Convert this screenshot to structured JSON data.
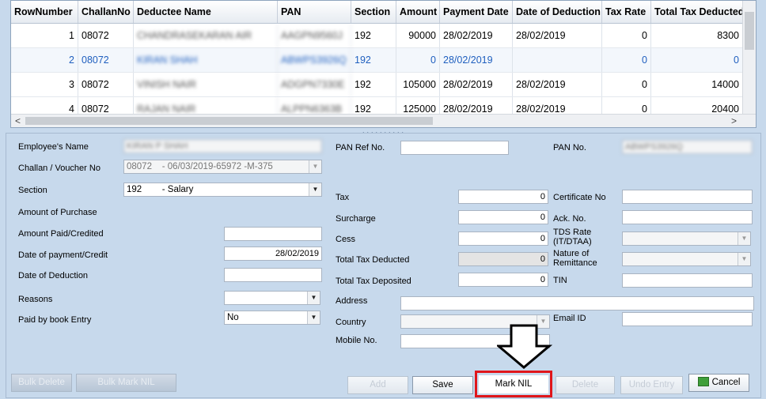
{
  "grid": {
    "columns": [
      "RowNumber",
      "ChallanNo",
      "Deductee Name",
      "PAN",
      "Section",
      "Amount",
      "Payment Date",
      "Date of Deduction",
      "Tax Rate",
      "Total Tax Deducted"
    ],
    "rows": [
      {
        "row": "1",
        "challan": "08072",
        "name": "CHANDRASEKARAN AIR",
        "pan": "AAGPN9560J",
        "section": "192",
        "amount": "90000",
        "payment_date": "28/02/2019",
        "deduction_date": "28/02/2019",
        "tax_rate": "0",
        "total_tax": "8300"
      },
      {
        "row": "2",
        "challan": "08072",
        "name": "KIRAN SHAH",
        "pan": "ABWPS3926Q",
        "section": "192",
        "amount": "0",
        "payment_date": "28/02/2019",
        "deduction_date": "",
        "tax_rate": "0",
        "total_tax": "0"
      },
      {
        "row": "3",
        "challan": "08072",
        "name": "VINISH NAIR",
        "pan": "ADGPN7330E",
        "section": "192",
        "amount": "105000",
        "payment_date": "28/02/2019",
        "deduction_date": "28/02/2019",
        "tax_rate": "0",
        "total_tax": "14000"
      },
      {
        "row": "4",
        "challan": "08072",
        "name": "RAJAN NAIR",
        "pan": "ALPPN6363B",
        "section": "192",
        "amount": "125000",
        "payment_date": "28/02/2019",
        "deduction_date": "28/02/2019",
        "tax_rate": "0",
        "total_tax": "20400"
      }
    ]
  },
  "form": {
    "employee_name_label": "Employee's Name",
    "employee_name_value": "KIRAN P SHAH",
    "challan_label": "Challan / Voucher No",
    "challan_value": "08072    - 06/03/2019-65972 -M-375",
    "section_label": "Section",
    "section_value": "192        - Salary",
    "amount_purchase_label": "Amount of Purchase",
    "amount_paid_label": "Amount Paid/Credited",
    "amount_paid_value": "",
    "date_payment_label": "Date of payment/Credit",
    "date_payment_value": "28/02/2019",
    "date_deduction_label": "Date of Deduction",
    "date_deduction_value": "",
    "reasons_label": "Reasons",
    "reasons_value": "",
    "paid_by_book_label": "Paid by book Entry",
    "paid_by_book_value": "No",
    "pan_ref_label": "PAN Ref No.",
    "pan_ref_value": "",
    "tax_label": "Tax",
    "tax_value": "0",
    "surcharge_label": "Surcharge",
    "surcharge_value": "0",
    "cess_label": "Cess",
    "cess_value": "0",
    "total_deducted_label": "Total Tax Deducted",
    "total_deducted_value": "0",
    "total_deposited_label": "Total Tax Deposited",
    "total_deposited_value": "0",
    "address_label": "Address",
    "address_value": "",
    "country_label": "Country",
    "country_value": "",
    "mobile_label": "Mobile No.",
    "mobile_value": "",
    "pan_no_label": "PAN No.",
    "pan_no_value": "ABWPS3926Q",
    "certificate_label": "Certificate No",
    "ack_label": "Ack. No.",
    "tds_rate_label_1": "TDS Rate",
    "tds_rate_label_2": "(IT/DTAA)",
    "nature_label_1": "Nature of",
    "nature_label_2": "Remittance",
    "tin_label": "TIN",
    "email_label": "Email ID"
  },
  "buttons": {
    "bulk_delete": "Bulk Delete",
    "bulk_mark_nil": "Bulk Mark NIL",
    "add": "Add",
    "save": "Save",
    "mark_nil": "Mark NIL",
    "delete": "Delete",
    "undo_entry": "Undo Entry",
    "cancel": "Cancel"
  },
  "colors": {
    "highlight": "#e0161b",
    "selected_text": "#1f5fbf",
    "panel_bg": "#c7d9ec"
  },
  "icons": [
    "scroll-left-icon",
    "scroll-right-icon",
    "dropdown-arrow-icon",
    "cancel-icon",
    "down-arrow-callout-icon"
  ]
}
